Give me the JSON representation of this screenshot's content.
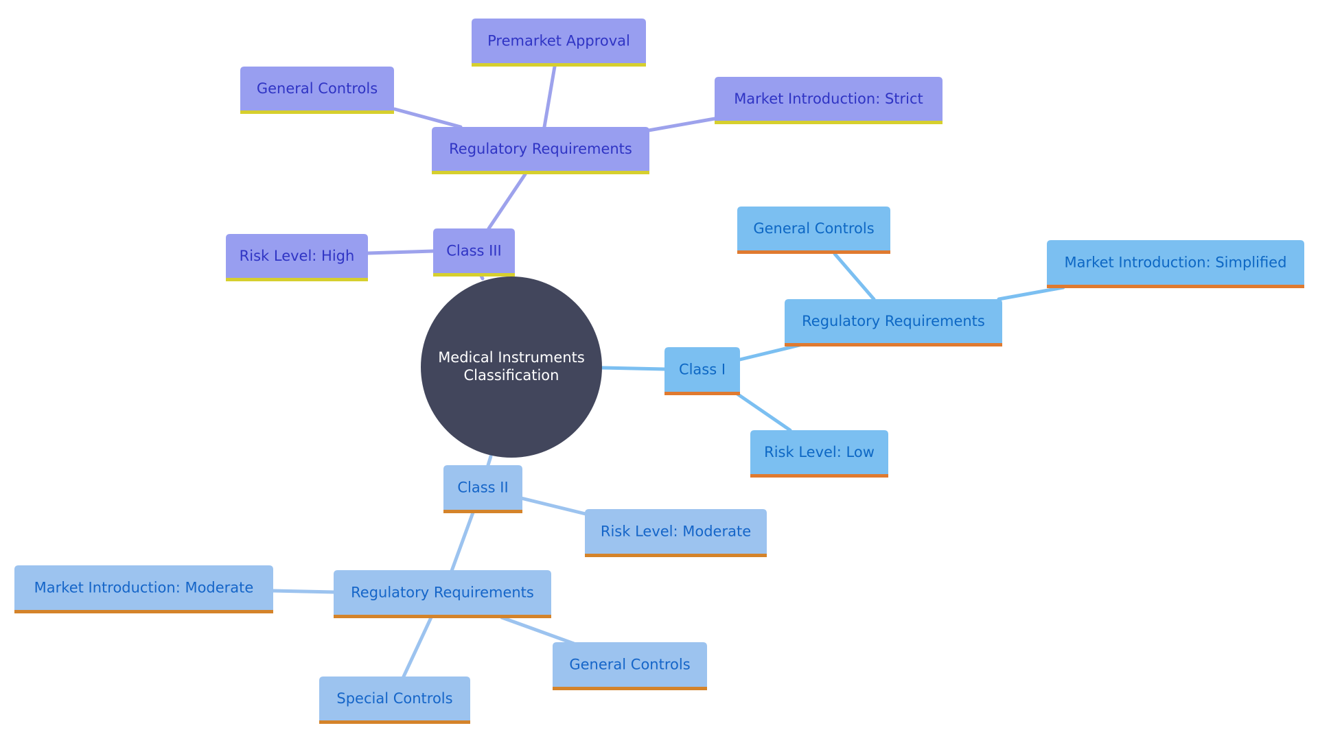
{
  "diagram": {
    "type": "mindmap",
    "root": {
      "id": "root",
      "label_lines": [
        "Medical Instruments",
        "Classification"
      ]
    },
    "themes": {
      "class3": {
        "fill": "#989ef0",
        "text": "#2f34c4",
        "underline": "#d6cf2e",
        "edge": "#9da2ec"
      },
      "class1": {
        "fill": "#7bbff1",
        "text": "#0d67c4",
        "underline": "#e07a2f",
        "edge": "#7bbff1"
      },
      "class2": {
        "fill": "#9cc3ef",
        "text": "#1565c8",
        "underline": "#d4832a",
        "edge": "#9cc3ef"
      },
      "root": {
        "fill": "#42465c",
        "text": "#ffffff"
      }
    },
    "nodes": [
      {
        "id": "c3",
        "label": "Class III",
        "theme": "class3",
        "parent": "root"
      },
      {
        "id": "c3-risk",
        "label": "Risk Level: High",
        "theme": "class3",
        "parent": "c3"
      },
      {
        "id": "c3-reg",
        "label": "Regulatory Requirements",
        "theme": "class3",
        "parent": "c3"
      },
      {
        "id": "c3-gc",
        "label": "General Controls",
        "theme": "class3",
        "parent": "c3-reg"
      },
      {
        "id": "c3-pma",
        "label": "Premarket Approval",
        "theme": "class3",
        "parent": "c3-reg"
      },
      {
        "id": "c3-market",
        "label": "Market Introduction: Strict",
        "theme": "class3",
        "parent": "c3-reg"
      },
      {
        "id": "c1",
        "label": "Class I",
        "theme": "class1",
        "parent": "root"
      },
      {
        "id": "c1-reg",
        "label": "Regulatory Requirements",
        "theme": "class1",
        "parent": "c1"
      },
      {
        "id": "c1-gc",
        "label": "General Controls",
        "theme": "class1",
        "parent": "c1-reg"
      },
      {
        "id": "c1-market",
        "label": "Market Introduction: Simplified",
        "theme": "class1",
        "parent": "c1-reg"
      },
      {
        "id": "c1-risk",
        "label": "Risk Level: Low",
        "theme": "class1",
        "parent": "c1"
      },
      {
        "id": "c2",
        "label": "Class II",
        "theme": "class2",
        "parent": "root"
      },
      {
        "id": "c2-risk",
        "label": "Risk Level: Moderate",
        "theme": "class2",
        "parent": "c2"
      },
      {
        "id": "c2-reg",
        "label": "Regulatory Requirements",
        "theme": "class2",
        "parent": "c2"
      },
      {
        "id": "c2-market",
        "label": "Market Introduction: Moderate",
        "theme": "class2",
        "parent": "c2-reg"
      },
      {
        "id": "c2-special",
        "label": "Special Controls",
        "theme": "class2",
        "parent": "c2-reg"
      },
      {
        "id": "c2-gc",
        "label": "General Controls",
        "theme": "class2",
        "parent": "c2-reg"
      }
    ]
  }
}
